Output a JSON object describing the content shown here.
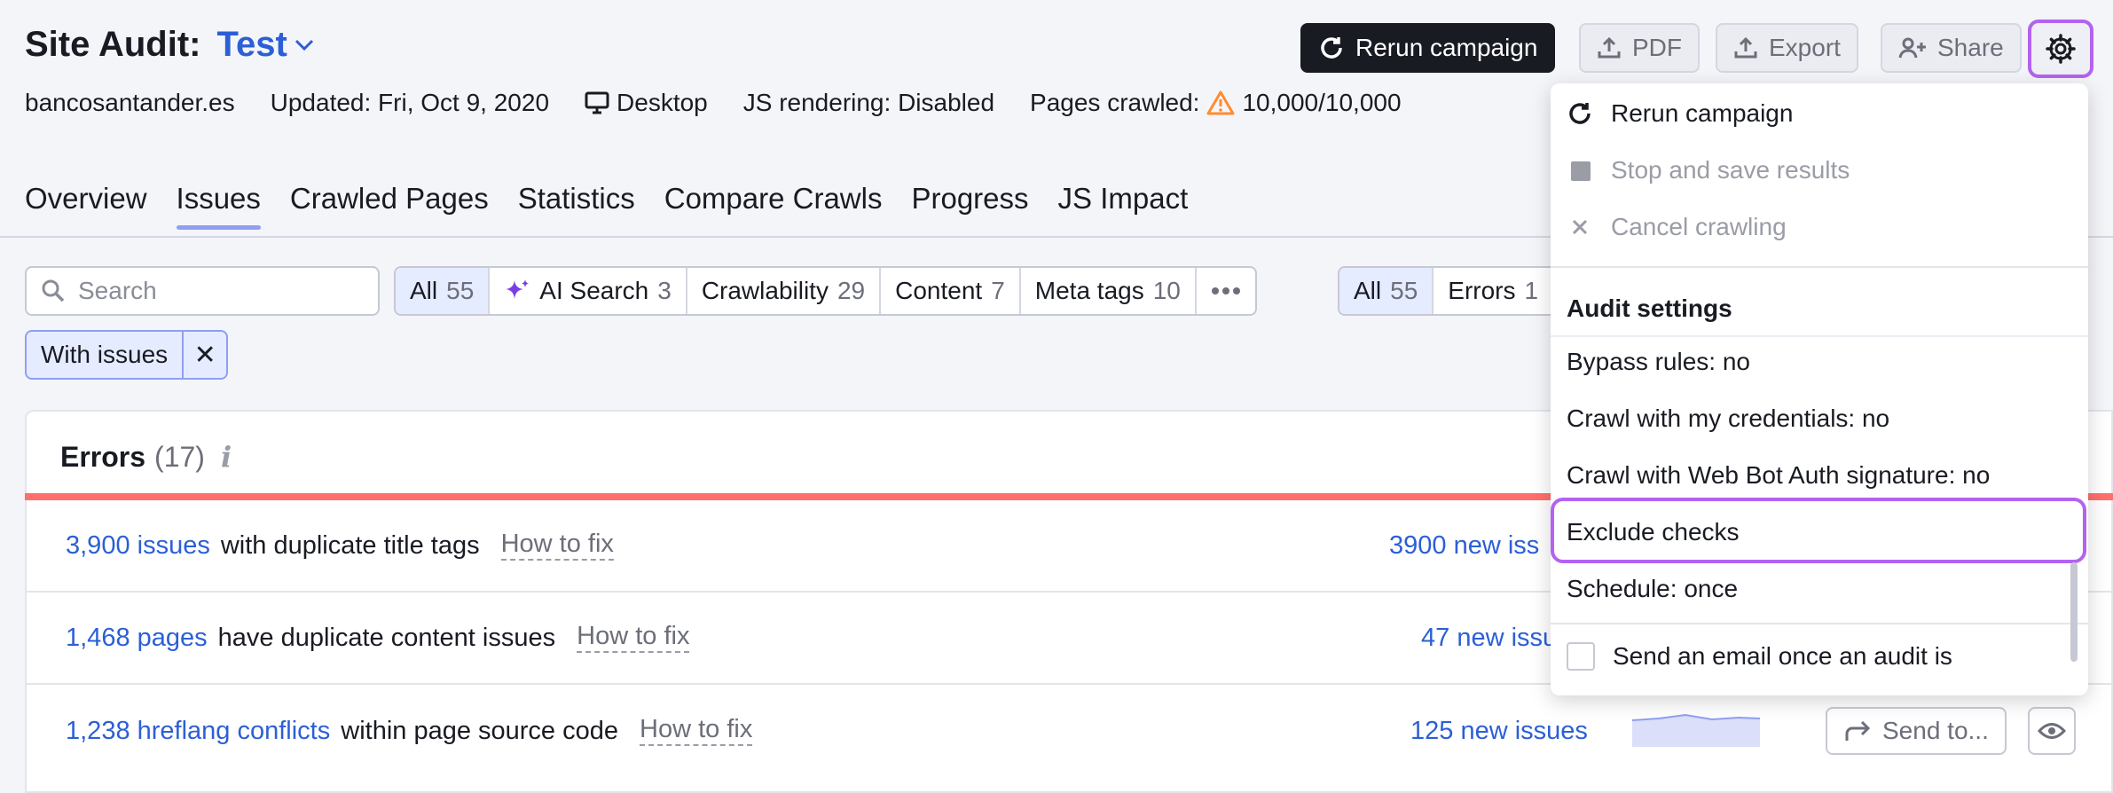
{
  "header": {
    "title": "Site Audit:",
    "project": "Test",
    "domain": "bancosantander.es",
    "updated": "Updated: Fri, Oct 9, 2020",
    "device": "Desktop",
    "js_rendering": "JS rendering: Disabled",
    "pages_crawled_label": "Pages crawled:",
    "pages_crawled_value": "10,000/10,000",
    "buttons": {
      "rerun": "Rerun campaign",
      "pdf": "PDF",
      "export": "Export",
      "share": "Share"
    }
  },
  "tabs": [
    "Overview",
    "Issues",
    "Crawled Pages",
    "Statistics",
    "Compare Crawls",
    "Progress",
    "JS Impact"
  ],
  "active_tab": "Issues",
  "filters": {
    "search_placeholder": "Search",
    "categories": [
      {
        "label": "All",
        "count": "55"
      },
      {
        "label": "AI Search",
        "count": "3"
      },
      {
        "label": "Crawlability",
        "count": "29"
      },
      {
        "label": "Content",
        "count": "7"
      },
      {
        "label": "Meta tags",
        "count": "10"
      }
    ],
    "severity": [
      {
        "label": "All",
        "count": "55"
      },
      {
        "label": "Errors",
        "count": "1"
      }
    ],
    "chip": "With issues"
  },
  "errors": {
    "title": "Errors",
    "count": "(17)",
    "info_icon": "i",
    "rows": [
      {
        "link": "3,900 issues",
        "text": "with duplicate title tags",
        "howfix": "How to fix",
        "new": "3900 new iss"
      },
      {
        "link": "1,468 pages",
        "text": "have duplicate content issues",
        "howfix": "How to fix",
        "new": "47 new issu"
      },
      {
        "link": "1,238 hreflang conflicts",
        "text": "within page source code",
        "howfix": "How to fix",
        "new": "125 new issues",
        "send": "Send to..."
      }
    ]
  },
  "menu": {
    "rerun": "Rerun campaign",
    "stop": "Stop and save results",
    "cancel": "Cancel crawling",
    "settings_title": "Audit settings",
    "bypass": "Bypass rules: no",
    "credentials": "Crawl with my credentials: no",
    "webbot": "Crawl with Web Bot Auth signature: no",
    "exclude": "Exclude checks",
    "schedule": "Schedule: once",
    "email": "Send an email once an audit is"
  },
  "colors": {
    "accent": "#2c5fd6",
    "highlight": "#b462f1",
    "error_bar": "#ff6f6b"
  }
}
